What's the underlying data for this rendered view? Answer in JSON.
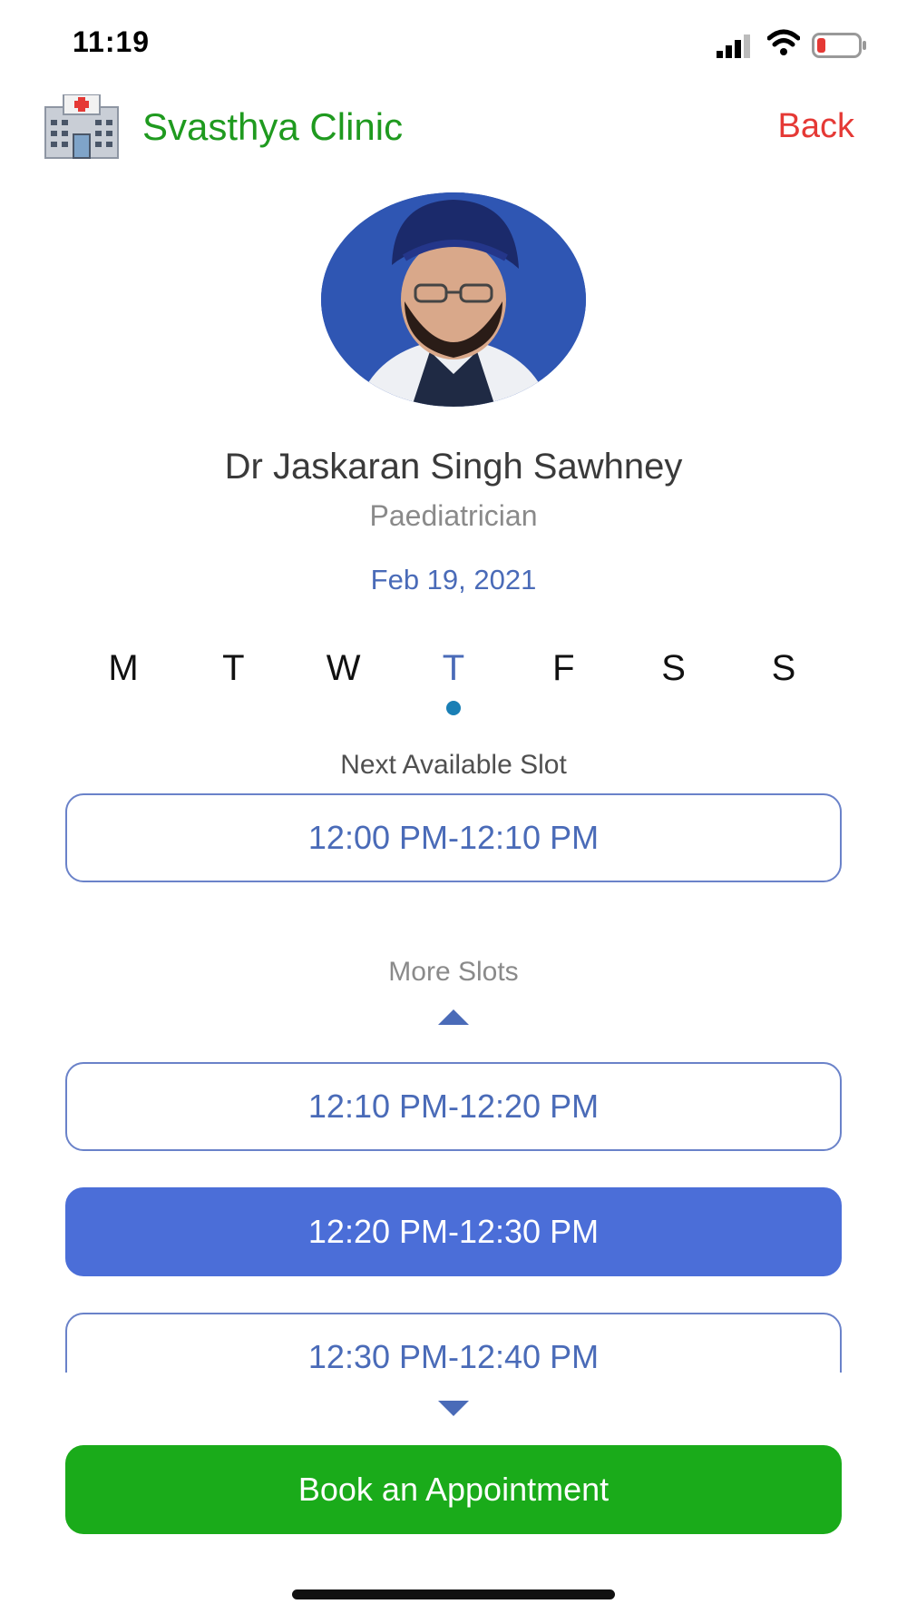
{
  "status_bar": {
    "time": "11:19",
    "icons": [
      "signal-icon",
      "wifi-icon",
      "battery-low-icon"
    ]
  },
  "header": {
    "clinic_name": "Svasthya Clinic",
    "logo_icon": "hospital-icon",
    "back_label": "Back",
    "colors": {
      "clinic_name": "#1f9a1f",
      "back": "#e53935"
    }
  },
  "doctor": {
    "name": "Dr Jaskaran Singh Sawhney",
    "specialty": "Paediatrician",
    "avatar": "doctor-photo"
  },
  "date": "Feb 19, 2021",
  "week": {
    "days": [
      "M",
      "T",
      "W",
      "T",
      "F",
      "S",
      "S"
    ],
    "selected_index": 3
  },
  "next_slot": {
    "label": "Next Available Slot",
    "time": "12:00 PM-12:10 PM"
  },
  "more_slots": {
    "label": "More Slots",
    "slots": [
      {
        "time": "12:10 PM-12:20 PM",
        "selected": false
      },
      {
        "time": "12:20 PM-12:30 PM",
        "selected": true
      },
      {
        "time": "12:30 PM-12:40 PM",
        "selected": false
      }
    ]
  },
  "book_button": "Book an Appointment",
  "colors": {
    "accent": "#4a6bb8",
    "selected_slot": "#4b6ed8",
    "book_button": "#1aab1a",
    "day_dot": "#1a7fb5"
  }
}
